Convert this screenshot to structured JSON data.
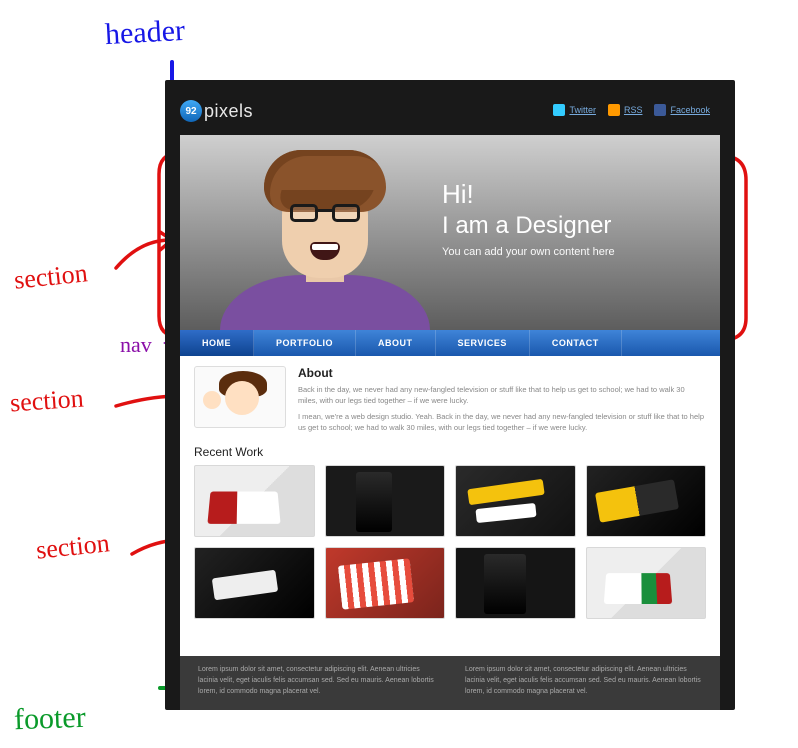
{
  "annotations": {
    "header": "header",
    "nav": "nav",
    "section1": "section",
    "section2": "section",
    "section3": "section",
    "footer": "footer"
  },
  "logo": {
    "badge": "92",
    "text": "pixels"
  },
  "socials": [
    {
      "id": "twitter",
      "label": "Twitter"
    },
    {
      "id": "rss",
      "label": "RSS"
    },
    {
      "id": "facebook",
      "label": "Facebook"
    }
  ],
  "hero": {
    "line1": "Hi!",
    "line2": "I am a Designer",
    "sub": "You can add your own content here"
  },
  "nav": {
    "items": [
      "HOME",
      "PORTFOLIO",
      "ABOUT",
      "SERVICES",
      "CONTACT"
    ],
    "active_index": 0
  },
  "about": {
    "heading": "About",
    "p1": "Back in the day, we never had any new-fangled television or stuff like that to help us get to school; we had to walk 30 miles, with our legs tied together – if we were lucky.",
    "p2": "I mean, we're a web design studio. Yeah. Back in the day, we never had any new-fangled television or stuff like that to help us get to school; we had to walk 30 miles, with our legs tied together – if we were lucky."
  },
  "recent": {
    "heading": "Recent Work",
    "items": [
      "work-1",
      "work-2",
      "work-3",
      "work-4",
      "work-5",
      "work-6",
      "work-7",
      "work-8"
    ]
  },
  "footer": {
    "col1": "Lorem ipsum dolor sit amet, consectetur adipiscing elit. Aenean ultricies lacinia velit, eget iaculis felis accumsan sed. Sed eu mauris. Aenean lobortis lorem, id commodo magna placerat vel.",
    "col2": "Lorem ipsum dolor sit amet, consectetur adipiscing elit. Aenean ultricies lacinia velit, eget iaculis felis accumsan sed. Sed eu mauris. Aenean lobortis lorem, id commodo magna placerat vel."
  },
  "colors": {
    "nav_blue": "#1a58ad",
    "hand_blue": "#1717e6",
    "hand_red": "#e01010",
    "hand_purple": "#8a0fa8",
    "hand_green": "#0a9a2a"
  }
}
